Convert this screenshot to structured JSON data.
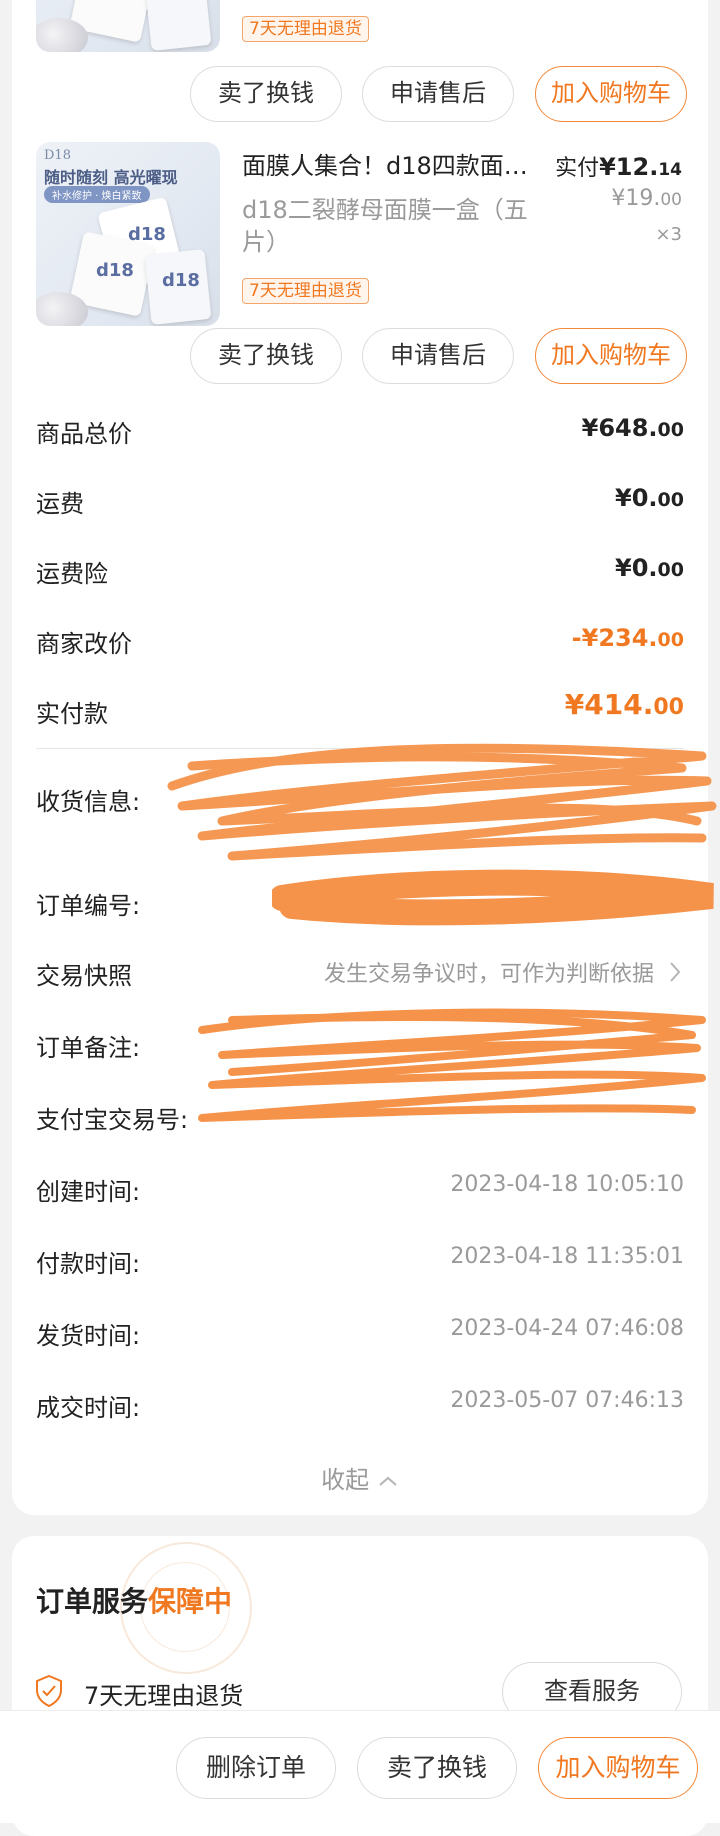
{
  "products": [
    {
      "tag": "7天无理由退货",
      "buttons": [
        "卖了换钱",
        "申请售后",
        "加入购物车"
      ]
    },
    {
      "title": "面膜人集合！d18四款面…",
      "subtitle": "d18二裂酵母面膜一盒（五片）",
      "tag": "7天无理由退货",
      "real_price_label": "实付",
      "real_price_int": "¥12.",
      "real_price_dec": "14",
      "orig_price_int": "¥19.",
      "orig_price_dec": "00",
      "qty": "×3",
      "image_text": {
        "brand": "D18",
        "headline": "随时随刻 高光曜现",
        "pill": "补水修护 · 焕白紧致",
        "box_logo": "d18"
      },
      "buttons": [
        "卖了换钱",
        "申请售后",
        "加入购物车"
      ]
    }
  ],
  "summary": {
    "goods_total": {
      "label": "商品总价",
      "int": "¥648.",
      "dec": "00"
    },
    "shipping": {
      "label": "运费",
      "int": "¥0.",
      "dec": "00"
    },
    "shipping_insurance": {
      "label": "运费险",
      "int": "¥0.",
      "dec": "00"
    },
    "merchant_adjust": {
      "label": "商家改价",
      "int": "-¥234.",
      "dec": "00"
    },
    "paid": {
      "label": "实付款",
      "int": "¥414.",
      "dec": "00"
    }
  },
  "info": {
    "receiver_label": "收货信息:",
    "order_no_label": "订单编号:",
    "snapshot_label": "交易快照",
    "snapshot_value": "发生交易争议时，可作为判断依据",
    "remark_label": "订单备注:",
    "alipay_label": "支付宝交易号:",
    "created_label": "创建时间:",
    "created_value": "2023-04-18 10:05:10",
    "paid_label": "付款时间:",
    "paid_value": "2023-04-18 11:35:01",
    "shipped_label": "发货时间:",
    "shipped_value": "2023-04-24 07:46:08",
    "closed_label": "成交时间:",
    "closed_value": "2023-05-07 07:46:13",
    "collapse_label": "收起"
  },
  "service": {
    "title_prefix": "订单服务",
    "title_highlight": "保障中",
    "item_label": "7天无理由退货",
    "view_button": "查看服务"
  },
  "bottom_bar": {
    "delete": "删除订单",
    "sell": "卖了换钱",
    "add_cart": "加入购物车"
  },
  "colors": {
    "accent": "#f07820",
    "redaction": "#f5934a"
  }
}
